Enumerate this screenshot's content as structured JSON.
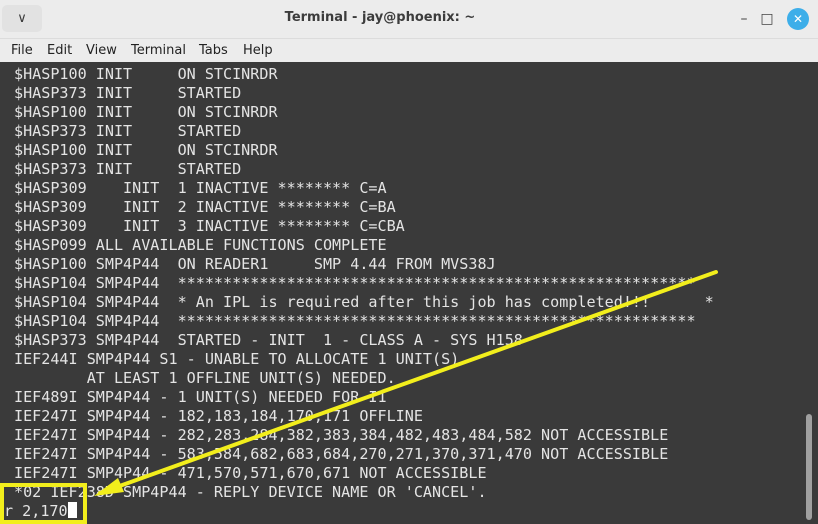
{
  "window": {
    "title": "Terminal - jay@phoenix: ~",
    "menu_glyph": "∨",
    "min_glyph": "–",
    "max_glyph": "□",
    "close_glyph": "✕"
  },
  "menubar": {
    "items": [
      "File",
      "Edit",
      "View",
      "Terminal",
      "Tabs",
      "Help"
    ]
  },
  "terminal": {
    "lines": [
      "$HASP100 INIT     ON STCINRDR",
      "$HASP373 INIT     STARTED",
      "$HASP100 INIT     ON STCINRDR",
      "$HASP373 INIT     STARTED",
      "$HASP100 INIT     ON STCINRDR",
      "$HASP373 INIT     STARTED",
      "$HASP309    INIT  1 INACTIVE ******** C=A",
      "$HASP309    INIT  2 INACTIVE ******** C=BA",
      "$HASP309    INIT  3 INACTIVE ******** C=CBA",
      "$HASP099 ALL AVAILABLE FUNCTIONS COMPLETE",
      "$HASP100 SMP4P44  ON READER1     SMP 4.44 FROM MVS38J",
      "$HASP104 SMP4P44  *********************************************************",
      "$HASP104 SMP4P44  * An IPL is required after this job has completed!!!      *",
      "$HASP104 SMP4P44  *********************************************************",
      "$HASP373 SMP4P44  STARTED - INIT  1 - CLASS A - SYS H158",
      "IEF244I SMP4P44 S1 - UNABLE TO ALLOCATE 1 UNIT(S)",
      "        AT LEAST 1 OFFLINE UNIT(S) NEEDED.",
      "IEF489I SMP4P44 - 1 UNIT(S) NEEDED FOR I1",
      "IEF247I SMP4P44 - 182,183,184,170,171 OFFLINE",
      "IEF247I SMP4P44 - 282,283,284,382,383,384,482,483,484,582 NOT ACCESSIBLE",
      "IEF247I SMP4P44 - 583,584,682,683,684,270,271,370,371,470 NOT ACCESSIBLE",
      "IEF247I SMP4P44 - 471,570,571,670,671 NOT ACCESSIBLE",
      "*02 IEF238D SMP4P44 - REPLY DEVICE NAME OR 'CANCEL'."
    ],
    "input": "r 2,170"
  },
  "annotation": {
    "color": "#f2ee1c"
  }
}
